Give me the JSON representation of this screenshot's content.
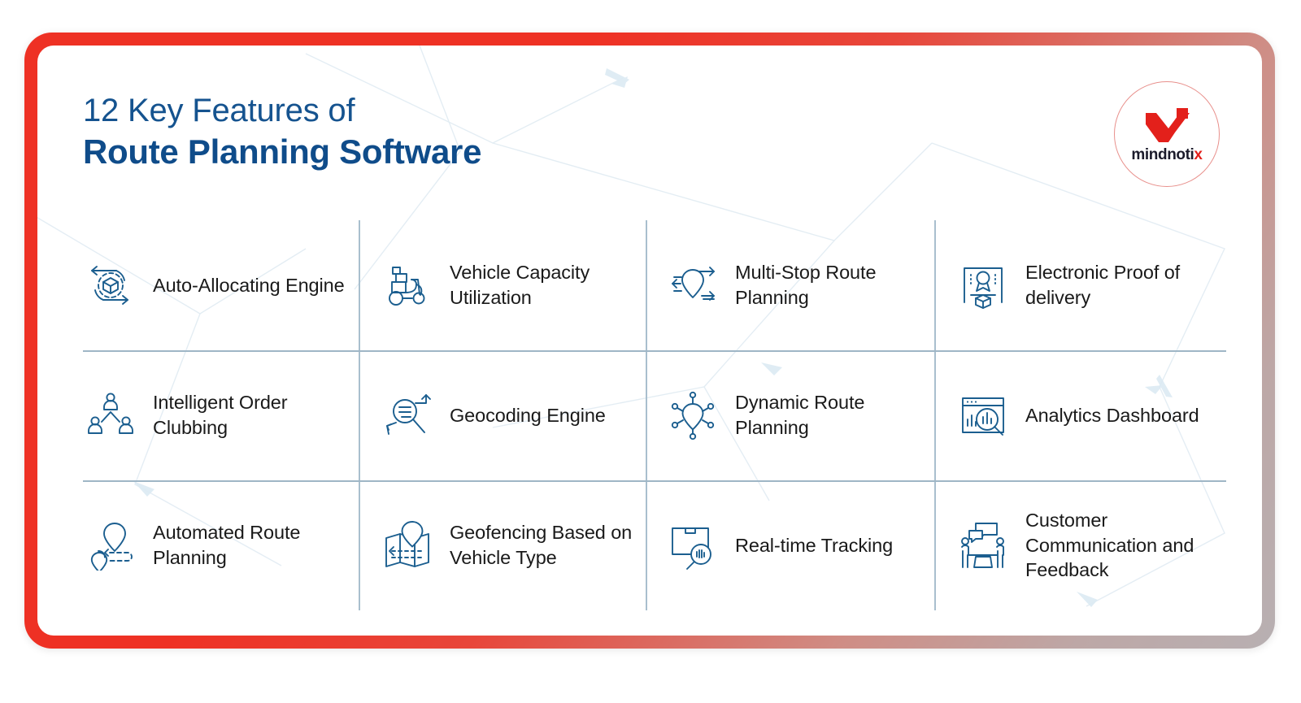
{
  "header": {
    "title_line_1": "12 Key Features of",
    "title_line_2": "Route Planning Software"
  },
  "logo": {
    "wordmark_main": "mindnoti",
    "wordmark_accent": "x",
    "mark_icon": "x-logo-icon",
    "accent_color": "#e3201b",
    "ring_color": "#e8908c"
  },
  "theme": {
    "frame_start_color": "#ee3124",
    "frame_end_color": "#b8b0b2",
    "title_color_light": "#15538f",
    "title_color_bold": "#0f4c8a",
    "icon_color": "#1b5e8f",
    "divider_color": "#a9bfce",
    "label_color": "#1a1a1a",
    "background_color": "#ffffff"
  },
  "features": [
    {
      "index": 1,
      "label": "Auto-Allocating Engine",
      "icon": "gear-box-arrows-icon",
      "row": 1,
      "col": 1
    },
    {
      "index": 2,
      "label": "Vehicle Capacity Utilization",
      "icon": "delivery-scooter-icon",
      "row": 1,
      "col": 2
    },
    {
      "index": 3,
      "label": "Multi-Stop Route Planning",
      "icon": "map-pin-arrows-icon",
      "row": 1,
      "col": 3
    },
    {
      "index": 4,
      "label": "Electronic Proof of delivery",
      "icon": "certificate-package-icon",
      "row": 1,
      "col": 4
    },
    {
      "index": 5,
      "label": "Intelligent Order Clubbing",
      "icon": "people-hierarchy-icon",
      "row": 2,
      "col": 1
    },
    {
      "index": 6,
      "label": "Geocoding Engine",
      "icon": "magnifier-arrows-icon",
      "row": 2,
      "col": 2
    },
    {
      "index": 7,
      "label": "Dynamic Route Planning",
      "icon": "pin-network-nodes-icon",
      "row": 2,
      "col": 3
    },
    {
      "index": 8,
      "label": "Analytics Dashboard",
      "icon": "dashboard-chart-magnifier-icon",
      "row": 2,
      "col": 4
    },
    {
      "index": 9,
      "label": "Automated Route Planning",
      "icon": "two-pins-dashed-path-icon",
      "row": 3,
      "col": 1
    },
    {
      "index": 10,
      "label": "Geofencing Based on Vehicle Type",
      "icon": "folded-map-pin-icon",
      "row": 3,
      "col": 2
    },
    {
      "index": 11,
      "label": "Real-time Tracking",
      "icon": "package-magnifier-signal-icon",
      "row": 3,
      "col": 3
    },
    {
      "index": 12,
      "label": "Customer Communication and Feedback",
      "icon": "people-speech-bubbles-icon",
      "row": 3,
      "col": 4
    }
  ]
}
